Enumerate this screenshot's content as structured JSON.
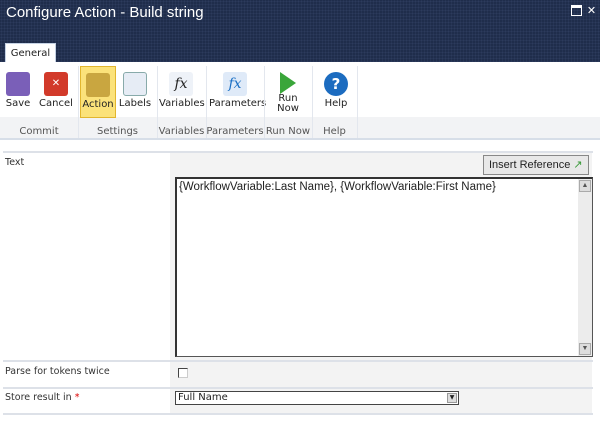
{
  "window": {
    "title": "Configure Action - Build string"
  },
  "tabs": [
    {
      "label": "General"
    }
  ],
  "ribbon": {
    "buttons": [
      {
        "label": "Save"
      },
      {
        "label": "Cancel"
      },
      {
        "label": "Action"
      },
      {
        "label": "Labels"
      },
      {
        "label": "Variables"
      },
      {
        "label": "Parameters"
      },
      {
        "label": "Run Now"
      },
      {
        "label": "Help"
      }
    ],
    "groups": [
      {
        "label": "Commit"
      },
      {
        "label": "Settings"
      },
      {
        "label": "Variables"
      },
      {
        "label": "Parameters"
      },
      {
        "label": "Run Now"
      },
      {
        "label": "Help"
      }
    ]
  },
  "form": {
    "text_label": "Text",
    "insert_reference": "Insert Reference",
    "text_value": "{WorkflowVariable:Last Name}, {WorkflowVariable:First Name}",
    "parse_label": "Parse for tokens twice",
    "parse_checked": false,
    "store_label": "Store result in",
    "required_mark": "*",
    "store_value": "Full Name"
  }
}
